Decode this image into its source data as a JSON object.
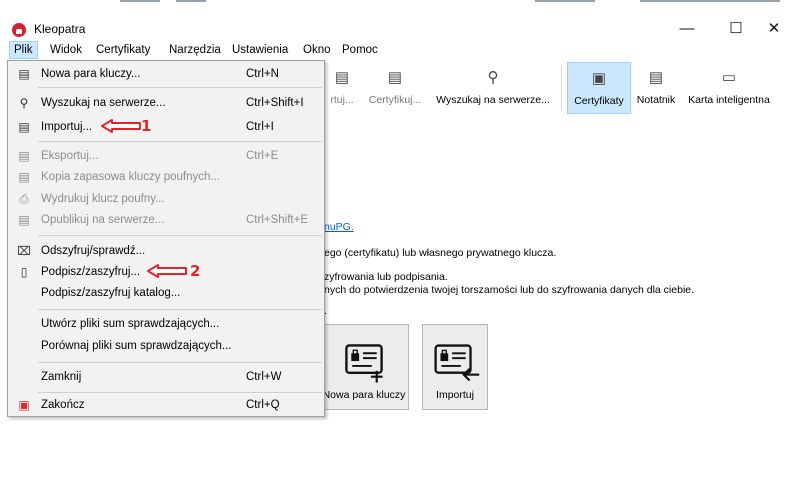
{
  "app": {
    "title": "Kleopatra"
  },
  "window_controls": {
    "minimize": "—",
    "maximize": "☐",
    "close": "✕"
  },
  "menubar": [
    "Plik",
    "Widok",
    "Certyfikaty",
    "Narzędzia",
    "Ustawienia",
    "Okno",
    "Pomoc"
  ],
  "toolbar": {
    "partial_1": "rtuj...",
    "partial_2": "Certyfikuj...",
    "search": "Wyszukaj na serwerze...",
    "certificates": "Certyfikaty",
    "notepad": "Notatnik",
    "smartcard": "Karta inteligentna"
  },
  "content": {
    "link_fragment": "nuPG.",
    "line1": "ego (certyfikatu) lub własnego prywatnego klucza.",
    "line2": "zyfrowania lub podpisania.",
    "line3": "nych do potwierdzenia twojej torszamości lub do szyfrowania danych dla ciebie.",
    "dot": "."
  },
  "tiles": {
    "new_keypair": "Nowa para kluczy",
    "import": "Importuj"
  },
  "file_menu": [
    {
      "label": "Nowa para kluczy...",
      "shortcut": "Ctrl+N",
      "icon": "keypair-icon",
      "glyph": "▤",
      "enabled": true
    },
    {
      "label": "Wyszukaj na serwerze...",
      "shortcut": "Ctrl+Shift+I",
      "icon": "search-icon",
      "glyph": "⚲",
      "enabled": true
    },
    {
      "label": "Importuj...",
      "shortcut": "Ctrl+I",
      "icon": "import-icon",
      "glyph": "▤",
      "enabled": true
    },
    {
      "label": "Eksportuj...",
      "shortcut": "Ctrl+E",
      "icon": "export-icon",
      "glyph": "▤",
      "enabled": false
    },
    {
      "label": "Kopia zapasowa kluczy poufnych...",
      "shortcut": "",
      "icon": "backup-icon",
      "glyph": "▤",
      "enabled": false
    },
    {
      "label": "Wydrukuj klucz poufny...",
      "shortcut": "",
      "icon": "print-icon",
      "glyph": "⎙",
      "enabled": false
    },
    {
      "label": "Opublikuj na serwerze...",
      "shortcut": "Ctrl+Shift+E",
      "icon": "publish-icon",
      "glyph": "▤",
      "enabled": false
    },
    {
      "label": "Odszyfruj/sprawdź...",
      "shortcut": "",
      "icon": "decrypt-icon",
      "glyph": "⌧",
      "enabled": true
    },
    {
      "label": "Podpisz/zaszyfruj...",
      "shortcut": "",
      "icon": "sign-encrypt-icon",
      "glyph": "▯",
      "enabled": true
    },
    {
      "label": "Podpisz/zaszyfruj katalog...",
      "shortcut": "",
      "icon": "",
      "glyph": "",
      "enabled": true
    },
    {
      "label": "Utwórz pliki sum sprawdzających...",
      "shortcut": "",
      "icon": "",
      "glyph": "",
      "enabled": true
    },
    {
      "label": "Porównaj pliki sum sprawdzających...",
      "shortcut": "",
      "icon": "",
      "glyph": "",
      "enabled": true
    },
    {
      "label": "Zamknij",
      "shortcut": "Ctrl+W",
      "icon": "",
      "glyph": "",
      "enabled": true
    },
    {
      "label": "Zakończ",
      "shortcut": "Ctrl+Q",
      "icon": "quit-icon",
      "glyph": "▣",
      "enabled": true
    }
  ],
  "annotations": {
    "first": "1",
    "second": "2",
    "color": "#e0252b"
  }
}
